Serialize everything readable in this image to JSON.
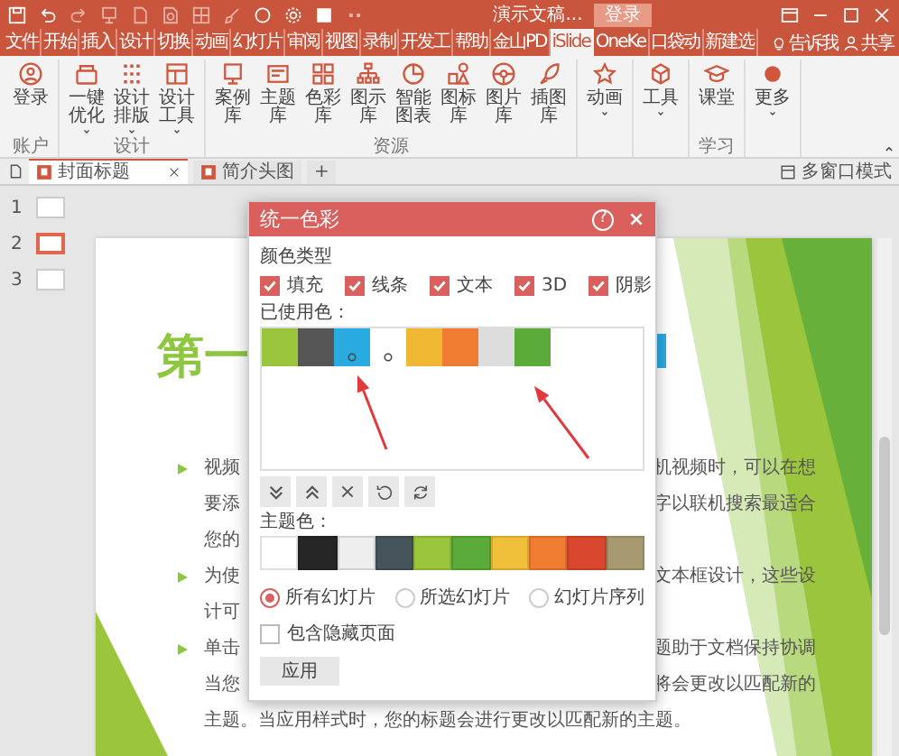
{
  "title_bar": {
    "document_title": "演示文稿...",
    "login_button": "登录"
  },
  "menu_tabs": [
    {
      "label": "文件",
      "selected": false
    },
    {
      "label": "开始",
      "selected": false
    },
    {
      "label": "插入",
      "selected": false
    },
    {
      "label": "设计",
      "selected": false
    },
    {
      "label": "切换",
      "selected": false
    },
    {
      "label": "动画",
      "selected": false
    },
    {
      "label": "幻灯片",
      "selected": false
    },
    {
      "label": "审阅",
      "selected": false
    },
    {
      "label": "视图",
      "selected": false
    },
    {
      "label": "录制",
      "selected": false
    },
    {
      "label": "开发工",
      "selected": false
    },
    {
      "label": "帮助",
      "selected": false
    },
    {
      "label": "金山PD",
      "selected": false
    },
    {
      "label": "iSlide",
      "selected": true
    },
    {
      "label": "OneKe",
      "selected": false
    },
    {
      "label": "口袋动",
      "selected": false
    },
    {
      "label": "新建选",
      "selected": false
    }
  ],
  "tell_me": "告诉我",
  "share": "共享",
  "ribbon": {
    "groups": [
      {
        "label": "账户",
        "buttons": [
          {
            "label": "登录",
            "dropdown": false
          }
        ]
      },
      {
        "label": "设计",
        "buttons": [
          {
            "label": "一键优化",
            "dropdown": true
          },
          {
            "label": "设计排版",
            "dropdown": true
          },
          {
            "label": "设计工具",
            "dropdown": true
          }
        ]
      },
      {
        "label": "资源",
        "buttons": [
          {
            "label": "案例库",
            "dropdown": false
          },
          {
            "label": "主题库",
            "dropdown": false
          },
          {
            "label": "色彩库",
            "dropdown": false
          },
          {
            "label": "图示库",
            "dropdown": false
          },
          {
            "label": "智能图表",
            "dropdown": false
          },
          {
            "label": "图标库",
            "dropdown": false
          },
          {
            "label": "图片库",
            "dropdown": false
          },
          {
            "label": "插图库",
            "dropdown": false
          }
        ]
      },
      {
        "buttons": [
          {
            "label": "动画",
            "dropdown": true
          }
        ]
      },
      {
        "buttons": [
          {
            "label": "工具",
            "dropdown": true
          }
        ]
      },
      {
        "label": "学习",
        "buttons": [
          {
            "label": "课堂",
            "dropdown": false
          }
        ]
      },
      {
        "buttons": [
          {
            "label": "更多",
            "dropdown": true
          }
        ]
      }
    ]
  },
  "doc_tabs": [
    {
      "label": "封面标题",
      "selected": true
    },
    {
      "label": "简介头图",
      "selected": false
    }
  ],
  "new_tab": "+",
  "multi_window": "多窗口模式",
  "thumbnails": [
    {
      "number": "1",
      "selected": false
    },
    {
      "number": "2",
      "selected": true
    },
    {
      "number": "3",
      "selected": false
    }
  ],
  "slide": {
    "title": "第一",
    "lines": [
      {
        "bullet": true,
        "left": "视频",
        "right": "机视频时，可以在想"
      },
      {
        "bullet": false,
        "left": "要添",
        "right": "字以联机搜索最适合"
      },
      {
        "bullet": false,
        "left": "您的"
      },
      {
        "bullet": true,
        "left": "为使",
        "right": "文本框设计，这些设"
      },
      {
        "bullet": false,
        "left": "计可"
      },
      {
        "bullet": true,
        "left": "单击",
        "right": "题助于文档保持协调"
      },
      {
        "bullet": false,
        "left": "当您",
        "right": "将会更改以匹配新的"
      },
      {
        "bullet": false,
        "left": "主题。当应用样式时，您的标题会进行更改以匹配新的主题。"
      }
    ]
  },
  "dialog": {
    "title": "统一色彩",
    "help": "?",
    "color_types_label": "颜色类型",
    "color_types": [
      {
        "label": "填充",
        "checked": true
      },
      {
        "label": "线条",
        "checked": true
      },
      {
        "label": "文本",
        "checked": true
      },
      {
        "label": "3D",
        "checked": true
      },
      {
        "label": "阴影",
        "checked": true
      }
    ],
    "used_colors_label": "已使用色：",
    "used_colors": [
      {
        "color": "#9bc53d",
        "marked": false
      },
      {
        "color": "#555555",
        "marked": false
      },
      {
        "color": "#29abe2",
        "marked": true
      },
      {
        "color": "#ffffff",
        "marked": true
      },
      {
        "color": "#f0b733",
        "marked": false
      },
      {
        "color": "#ef7c30",
        "marked": false
      },
      {
        "color": "#dddddd",
        "marked": false
      },
      {
        "color": "#5aab3a",
        "marked": false
      }
    ],
    "theme_colors_label": "主题色：",
    "theme_colors": [
      {
        "color": "#ffffff"
      },
      {
        "color": "#262626"
      },
      {
        "color": "#eeeeee"
      },
      {
        "color": "#44545a"
      },
      {
        "color": "#9bc53d"
      },
      {
        "color": "#5aab3a"
      },
      {
        "color": "#f0c03a"
      },
      {
        "color": "#ef7c30"
      },
      {
        "color": "#d9472f"
      },
      {
        "color": "#a89a70"
      }
    ],
    "scope": [
      {
        "label": "所有幻灯片",
        "selected": true
      },
      {
        "label": "所选幻灯片",
        "selected": false
      },
      {
        "label": "幻灯片序列",
        "selected": false
      }
    ],
    "include_hidden": {
      "label": "包含隐藏页面",
      "checked": false
    },
    "apply_button": "应用"
  }
}
